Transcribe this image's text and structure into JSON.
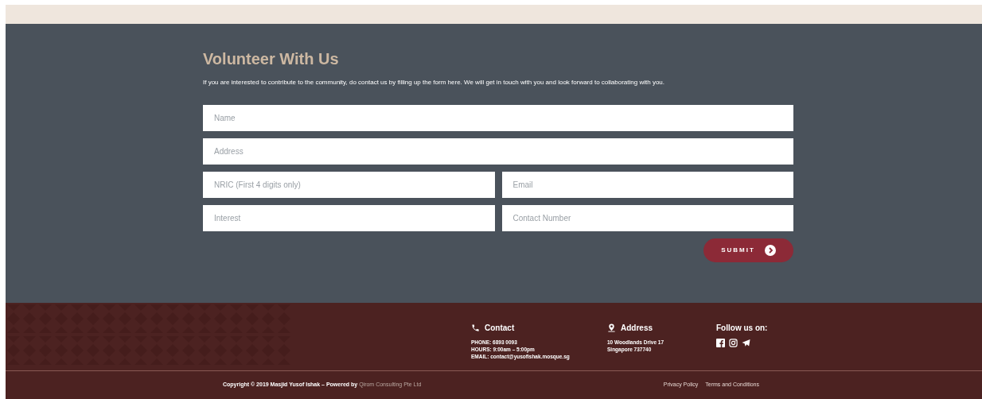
{
  "form": {
    "title": "Volunteer With Us",
    "intro": "If you are interested to contribute to the community, do contact us by filling up the form here. We will get in touch with you and look forward to collaborating with you.",
    "fields": [
      {
        "placeholder": "Name",
        "kind": "wide"
      },
      {
        "placeholder": "Address",
        "kind": "wide"
      },
      {
        "placeholder": "NRIC (First 4 digits only)",
        "kind": "narrow"
      },
      {
        "placeholder": "Email",
        "kind": "narrow"
      },
      {
        "placeholder": "Interest",
        "kind": "narrow"
      },
      {
        "placeholder": "Contact Number",
        "kind": "narrow"
      }
    ],
    "submit": "SUBMIT"
  },
  "footer": {
    "contact": {
      "heading": "Contact",
      "lines": [
        "PHONE: 6893 0093",
        "HOURS: 9:00am – 5:00pm",
        "EMAIL: contact@yusofishak.mosque.sg"
      ]
    },
    "address": {
      "heading": "Address",
      "lines": [
        "10 Woodlands Drive 17",
        "Singapore 737740"
      ]
    },
    "follow": {
      "heading": "Follow us on:"
    },
    "copyright": "Copyright © 2019 Masjid Yusof Ishak – Powered by",
    "powered_link": "Qirom Consulting Pte Ltd",
    "links": [
      "Privacy Policy",
      "Terms and Conditions"
    ]
  }
}
